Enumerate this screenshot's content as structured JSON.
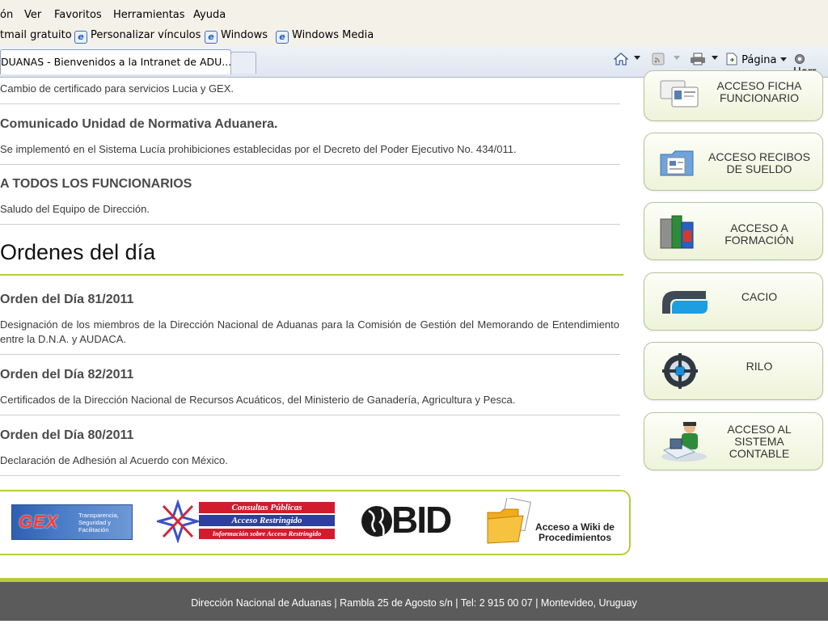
{
  "browser": {
    "menu": [
      "ón",
      "Ver",
      "Favoritos",
      "Herramientas",
      "Ayuda"
    ],
    "links": [
      "tmail gratuito",
      "Personalizar vínculos",
      "Windows",
      "Windows Media"
    ],
    "tab_title": "DUANAS - Bienvenidos a la Intranet de ADU...",
    "commands": {
      "page": "Página",
      "tools": "Herr"
    }
  },
  "news": [
    {
      "desc": "Cambio de certificado para servicios Lucia y GEX."
    },
    {
      "title": "Comunicado Unidad de Normativa Aduanera.",
      "desc": "Se implementó en el Sistema Lucía prohibiciones establecidas por el Decreto del Poder Ejecutivo No. 434/011."
    },
    {
      "title": "A TODOS LOS FUNCIONARIOS",
      "desc": "Saludo del Equipo de Dirección."
    }
  ],
  "orders": {
    "section_title": "Ordenes del día",
    "items": [
      {
        "title": "Orden del Día 81/2011",
        "desc": "Designación de los miembros de la Dirección Nacional de Aduanas para la Comisión de Gestión del Memorando de Entendimiento entre la D.N.A. y AUDACA."
      },
      {
        "title": "Orden del Día 82/2011",
        "desc": "Certificados de la Dirección Nacional de Recursos Acuáticos, del Ministerio de Ganadería, Agricultura y Pesca."
      },
      {
        "title": "Orden del Día 80/2011",
        "desc": "Declaración de Adhesión al Acuerdo con México."
      }
    ]
  },
  "sidebar": [
    {
      "line1": "ACCESO FICHA",
      "line2": "FUNCIONARIO",
      "line3": ""
    },
    {
      "line1": "ACCESO RECIBOS",
      "line2": "DE SUELDO",
      "line3": ""
    },
    {
      "line1": "ACCESO A",
      "line2": "FORMACIÓN",
      "line3": ""
    },
    {
      "line1": "CACIO",
      "line2": "",
      "line3": ""
    },
    {
      "line1": "RILO",
      "line2": "",
      "line3": ""
    },
    {
      "line1": "ACCESO AL",
      "line2": "SISTEMA",
      "line3": "CONTABLE"
    }
  ],
  "logos": {
    "gex": {
      "brand": "GEX",
      "tag1": "Transparencia,",
      "tag2": "Seguridad y",
      "tag3": "Facilitación"
    },
    "consultas": {
      "line1": "Consultas Públicas",
      "line2": "Acceso Restringido",
      "line3": "Información sobre Acceso Restringido"
    },
    "bid": "BID",
    "wiki": {
      "line1": "Acceso a Wiki de",
      "line2": "Procedimientos"
    }
  },
  "footer": "Dirección Nacional de Aduanas | Rambla 25 de Agosto s/n | Tel: 2 915 00 07 | Montevideo, Uruguay"
}
